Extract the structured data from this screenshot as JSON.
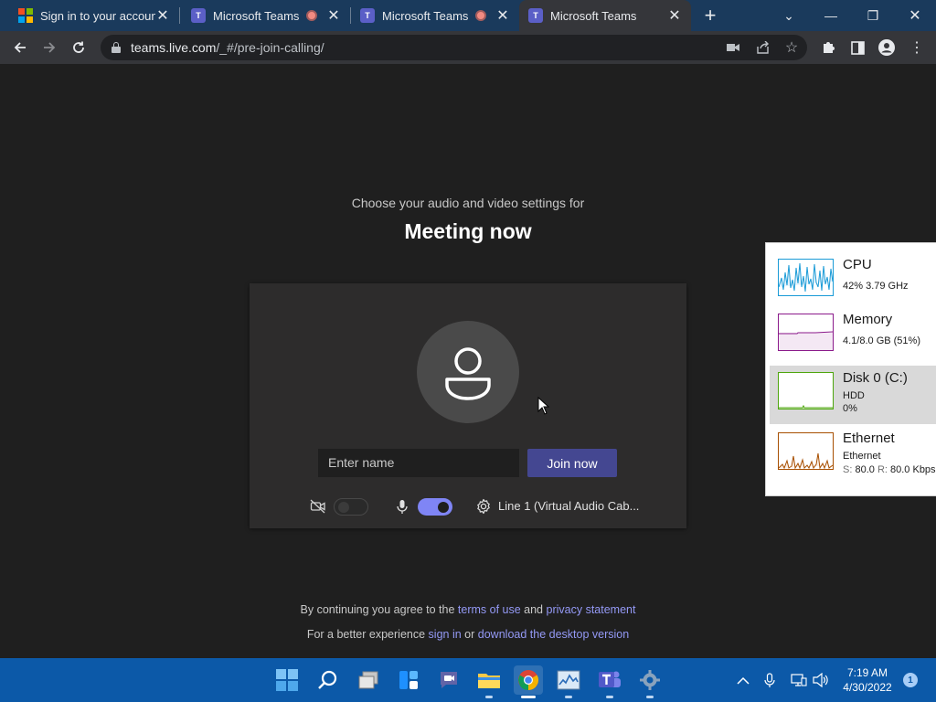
{
  "browser": {
    "tabs": [
      {
        "title": "Sign in to your account",
        "favicon": "microsoft-logo-icon",
        "recording": false,
        "active": false
      },
      {
        "title": "Microsoft Teams",
        "favicon": "teams-icon",
        "recording": true,
        "active": false
      },
      {
        "title": "Microsoft Teams",
        "favicon": "teams-icon",
        "recording": true,
        "active": false
      },
      {
        "title": "Microsoft Teams",
        "favicon": "teams-icon",
        "recording": false,
        "active": true
      }
    ],
    "url_host": "teams.live.com",
    "url_path": "/_#/pre-join-calling/"
  },
  "page": {
    "subheading": "Choose your audio and video settings for",
    "meeting_title": "Meeting now",
    "name_placeholder": "Enter name",
    "join_label": "Join now",
    "camera_on": false,
    "mic_on": true,
    "audio_device": "Line 1 (Virtual Audio Cab...",
    "legal": {
      "prefix": "By continuing you agree to the",
      "terms": "terms of use",
      "and": "and",
      "privacy": "privacy statement",
      "prefix2": "For a better experience",
      "signin": "sign in",
      "or": "or",
      "download": "download the desktop version"
    }
  },
  "taskmanager": {
    "items": [
      {
        "name": "CPU",
        "detail": "42% 3.79 GHz",
        "color": "#1a9bd7"
      },
      {
        "name": "Memory",
        "detail": "4.1/8.0 GB (51%)",
        "color": "#8b1a8b"
      },
      {
        "name": "Disk 0 (C:)",
        "detail_line1": "HDD",
        "detail_line2": "0%",
        "color": "#4da60c"
      },
      {
        "name": "Ethernet",
        "detail_line1": "Ethernet",
        "s_label": "S:",
        "s_value": "80.0",
        "r_label": "R:",
        "r_value": "80.0 Kbps",
        "color": "#a74f01"
      }
    ]
  },
  "taskbar": {
    "time": "7:19 AM",
    "date": "4/30/2022",
    "notifications": "1"
  },
  "colors": {
    "accent": "#444791",
    "toggle_on": "#7f85f5",
    "link": "#9499f5",
    "taskbar": "#0c59a8"
  }
}
